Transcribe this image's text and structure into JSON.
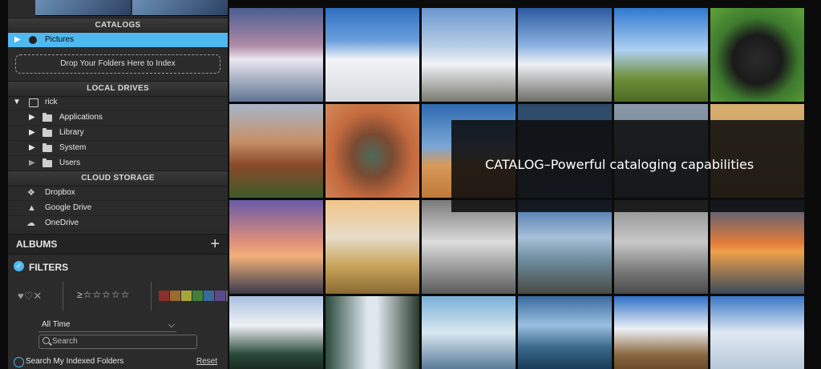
{
  "sidebar": {
    "catalogs_header": "CATALOGS",
    "pictures_label": "Pictures",
    "drop_zone": "Drop Your Folders Here to Index",
    "local_drives_header": "LOCAL DRIVES",
    "user_label": "rick",
    "folders": [
      {
        "label": "Applications"
      },
      {
        "label": "Library"
      },
      {
        "label": "System"
      },
      {
        "label": "Users"
      }
    ],
    "cloud_header": "CLOUD STORAGE",
    "cloud_items": [
      {
        "label": "Dropbox",
        "icon": "dropbox-icon"
      },
      {
        "label": "Google Drive",
        "icon": "google-drive-icon"
      },
      {
        "label": "OneDrive",
        "icon": "onedrive-icon"
      }
    ],
    "albums_label": "ALBUMS",
    "filters_label": "FILTERS",
    "rating_prefix": "≥☆☆☆☆☆",
    "time_filter": "All Time",
    "search_placeholder": "Search",
    "search_scope": "Search My Indexed Folders",
    "reset_label": "Reset",
    "color_swatches": [
      "#8a2e2e",
      "#9a6a2e",
      "#a6a63a",
      "#3f7f3a",
      "#3a6a9a",
      "#5a4a8a",
      "#6a6a6a"
    ]
  },
  "overlay": {
    "caption": "CATALOG–Powerful cataloging capabilities"
  },
  "colors": {
    "accent": "#4fb8ef"
  }
}
